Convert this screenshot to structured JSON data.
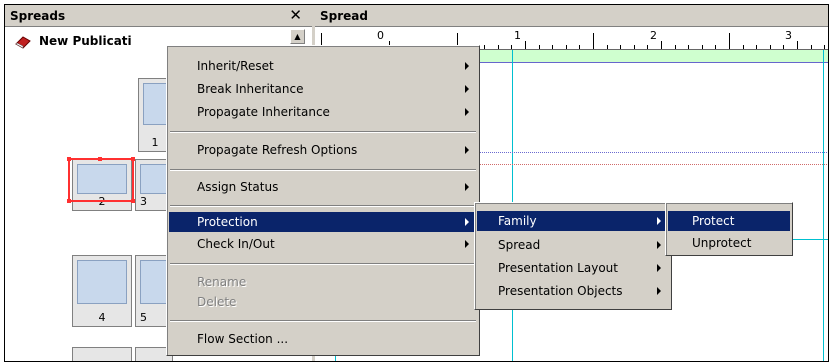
{
  "spreads_panel": {
    "title": "Spreads",
    "publication": "New Publicati"
  },
  "pages": [
    "1",
    "2",
    "3",
    "4",
    "5"
  ],
  "spread_panel": {
    "title": "Spread",
    "ruler_labels": [
      "0",
      "1",
      "2",
      "3"
    ]
  },
  "context_menu": {
    "items": [
      {
        "label": "Inherit/Reset",
        "submenu": true
      },
      {
        "label": "Break Inheritance",
        "submenu": true
      },
      {
        "label": "Propagate Inheritance",
        "submenu": true
      },
      {
        "label": "Propagate Refresh Options",
        "submenu": true
      },
      {
        "label": "Assign Status",
        "submenu": true
      },
      {
        "label": "Protection",
        "submenu": true,
        "highlighted": true
      },
      {
        "label": "Check In/Out",
        "submenu": true
      },
      {
        "label": "Rename",
        "disabled": true
      },
      {
        "label": "Delete",
        "disabled": true
      },
      {
        "label": "Flow Section ..."
      }
    ]
  },
  "protection_submenu": {
    "items": [
      {
        "label": "Family",
        "submenu": true,
        "highlighted": true
      },
      {
        "label": "Spread",
        "submenu": true
      },
      {
        "label": "Presentation Layout",
        "submenu": true
      },
      {
        "label": "Presentation Objects",
        "submenu": true
      }
    ]
  },
  "family_submenu": {
    "items": [
      {
        "label": "Protect",
        "highlighted": true
      },
      {
        "label": "Unprotect"
      }
    ]
  },
  "colors": {
    "highlight": "#0a246a",
    "selection": "#ff3030",
    "guide": "#00c0d0",
    "face": "#d4d0c8"
  }
}
